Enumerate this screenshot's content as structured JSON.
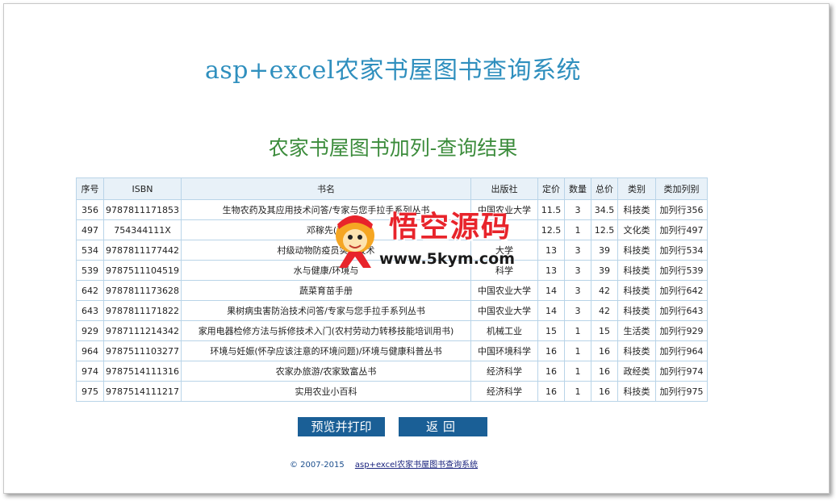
{
  "page": {
    "title": "asp+excel农家书屋图书查询系统",
    "subtitle": "农家书屋图书加列-查询结果"
  },
  "table": {
    "headers": [
      "序号",
      "ISBN",
      "书名",
      "出版社",
      "定价",
      "数量",
      "总价",
      "类别",
      "类加列别"
    ],
    "rows": [
      [
        "356",
        "9787811171853",
        "生物农药及其应用技术问答/专家与您手拉手系列丛书",
        "中国农业大学",
        "11.5",
        "3",
        "34.5",
        "科技类",
        "加列行356"
      ],
      [
        "497",
        "754344111X",
        "邓稼先(科",
        "育",
        "12.5",
        "1",
        "12.5",
        "文化类",
        "加列行497"
      ],
      [
        "534",
        "9787811177442",
        "村级动物防疫员实用技术",
        "大学",
        "13",
        "3",
        "39",
        "科技类",
        "加列行534"
      ],
      [
        "539",
        "9787511104519",
        "水与健康/环境与",
        "科学",
        "13",
        "3",
        "39",
        "科技类",
        "加列行539"
      ],
      [
        "642",
        "9787811173628",
        "蔬菜育苗手册",
        "中国农业大学",
        "14",
        "3",
        "42",
        "科技类",
        "加列行642"
      ],
      [
        "643",
        "9787811171822",
        "果树病虫害防治技术问答/专家与您手拉手系列丛书",
        "中国农业大学",
        "14",
        "3",
        "42",
        "科技类",
        "加列行643"
      ],
      [
        "929",
        "9787111214342",
        "家用电器检修方法与拆修技术入门(农村劳动力转移技能培训用书)",
        "机械工业",
        "15",
        "1",
        "15",
        "生活类",
        "加列行929"
      ],
      [
        "964",
        "9787511103277",
        "环境与妊娠(怀孕应该注意的环境问题)/环境与健康科普丛书",
        "中国环境科学",
        "16",
        "1",
        "16",
        "科技类",
        "加列行964"
      ],
      [
        "974",
        "9787514111316",
        "农家办旅游/农家致富丛书",
        "经济科学",
        "16",
        "1",
        "16",
        "政经类",
        "加列行974"
      ],
      [
        "975",
        "9787514111217",
        "实用农业小百科",
        "经济科学",
        "16",
        "1",
        "16",
        "科技类",
        "加列行975"
      ]
    ]
  },
  "buttons": {
    "print": "预览并打印",
    "back": "返回"
  },
  "footer": {
    "copyright": "© 2007-2015",
    "link": "asp+excel农家书屋图书查询系统"
  },
  "watermark": {
    "text": "悟空源码",
    "url": "www.5kym.com"
  },
  "colors": {
    "title": "#2f8fbe",
    "subtitle": "#3c8c3c",
    "button": "#1a5f96",
    "header_bg": "#e8f1f8",
    "border": "#b9d4e8",
    "watermark": "#e8242b"
  }
}
